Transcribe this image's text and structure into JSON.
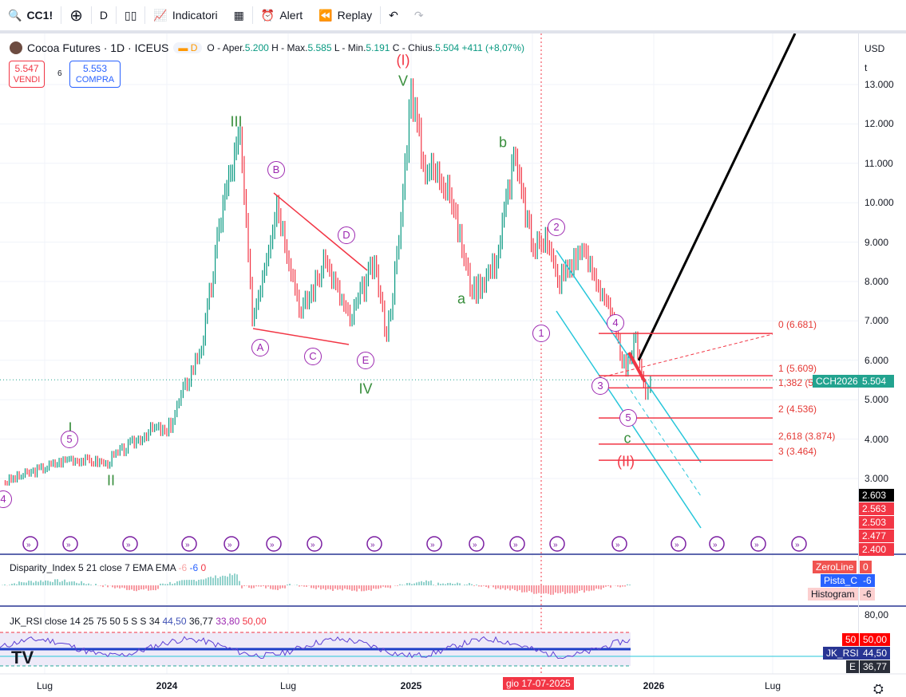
{
  "toolbar": {
    "symbol": "CC1!",
    "interval": "D",
    "indicators": "Indicatori",
    "alert": "Alert",
    "replay": "Replay"
  },
  "legend": {
    "title": "Cocoa Futures · 1D · ICEUS",
    "badge": "D",
    "o_label": "O - Aper.",
    "o": "5.200",
    "h_label": "H - Max.",
    "h": "5.585",
    "l_label": "L - Min.",
    "l": "5.191",
    "c_label": "C - Chius.",
    "c": "5.504",
    "change": "+411 (+8,07%)"
  },
  "trade": {
    "sell_price": "5.547",
    "sell_label": "VENDI",
    "spread": "6",
    "buy_price": "5.553",
    "buy_label": "COMPRA"
  },
  "axis": {
    "currency": "USD",
    "unit": "t",
    "ticks": [
      "13.000",
      "12.000",
      "11.000",
      "10.000",
      "9.000",
      "8.000",
      "7.000",
      "6.000",
      "5.000",
      "4.000",
      "3.000"
    ],
    "price_tag_symbol": "CCH2026",
    "price_tag": "5.504",
    "tags": [
      "2.603",
      "2.563",
      "2.503",
      "2.477",
      "2.400"
    ]
  },
  "fib": [
    "0 (6.681)",
    "1 (5.609)",
    "1,382 (5",
    "2 (4.536)",
    "2,618 (3.874)",
    "3 (3.464)"
  ],
  "waves": {
    "green": [
      "I",
      "II",
      "III",
      "IV",
      "V",
      "a",
      "b",
      "c"
    ],
    "red": [
      "(I)",
      "(II)"
    ],
    "circled": [
      "4",
      "5",
      "A",
      "B",
      "C",
      "D",
      "E",
      "1",
      "2",
      "3",
      "4",
      "5"
    ]
  },
  "disparity": {
    "title": "Disparity_Index 5 21 close 7 EMA EMA",
    "v1": "-6",
    "v2": "-6",
    "v3": "0",
    "labels": [
      {
        "name": "ZeroLine",
        "value": "0"
      },
      {
        "name": "Pista_C",
        "value": "-6"
      },
      {
        "name": "Histogram",
        "value": "-6"
      }
    ]
  },
  "rsi": {
    "title": "JK_RSI close 14 25 75 50 5 S S 34",
    "v1": "44,50",
    "v2": "36,77",
    "v3": "33,80",
    "v4": "50,00",
    "tick80": "80,00",
    "labels": [
      {
        "name": "50",
        "value": "50,00"
      },
      {
        "name": "JK_RSI",
        "value": "44,50"
      },
      {
        "name": "E",
        "value": "36,77"
      }
    ]
  },
  "time_axis": [
    "Lug",
    "2024",
    "Lug",
    "2025",
    "2026",
    "Lug"
  ],
  "crosshair_date": "gio 17-07-2025",
  "chart_data": {
    "type": "line",
    "series": [
      {
        "name": "CC1! close (approx)",
        "points": [
          [
            2023.33,
            2900
          ],
          [
            2023.6,
            3500
          ],
          [
            2023.75,
            3400
          ],
          [
            2023.95,
            4300
          ],
          [
            2024.0,
            4150
          ],
          [
            2024.15,
            6500
          ],
          [
            2024.23,
            10000
          ],
          [
            2024.3,
            11700
          ],
          [
            2024.35,
            7000
          ],
          [
            2024.45,
            10000
          ],
          [
            2024.55,
            7200
          ],
          [
            2024.65,
            8500
          ],
          [
            2024.75,
            7000
          ],
          [
            2024.85,
            8500
          ],
          [
            2024.9,
            6600
          ],
          [
            2024.95,
            9000
          ],
          [
            2025.0,
            12900
          ],
          [
            2025.05,
            11000
          ],
          [
            2025.15,
            10500
          ],
          [
            2025.25,
            7700
          ],
          [
            2025.35,
            8500
          ],
          [
            2025.42,
            11200
          ],
          [
            2025.5,
            8800
          ],
          [
            2025.55,
            9200
          ],
          [
            2025.6,
            8000
          ],
          [
            2025.7,
            8800
          ],
          [
            2025.8,
            7500
          ],
          [
            2025.88,
            5700
          ],
          [
            2025.92,
            6600
          ],
          [
            2025.96,
            5100
          ],
          [
            2025.98,
            5504
          ]
        ]
      }
    ]
  }
}
